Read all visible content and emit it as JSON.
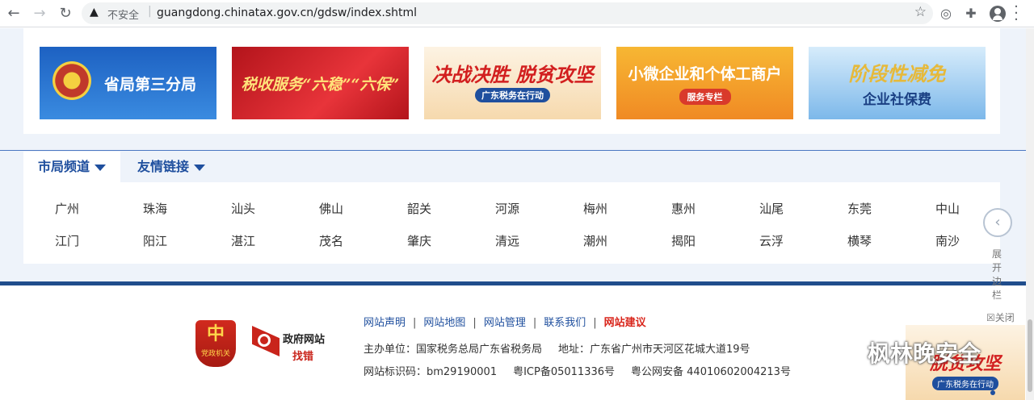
{
  "browser": {
    "back_icon": "arrow-left-icon",
    "forward_icon": "arrow-right-icon",
    "reload_icon": "reload-icon",
    "insecure_label": "不安全",
    "url": "guangdong.chinatax.gov.cn/gdsw/index.shtml"
  },
  "banners": [
    {
      "text": "省局第三分局"
    },
    {
      "text": "税收服务“六稳”“六保”"
    },
    {
      "text": "决战决胜 脱贫攻坚",
      "sub": "广东税务在行动"
    },
    {
      "text": "小微企业和个体工商户",
      "sub": "服务专栏"
    },
    {
      "text": "阶段性减免",
      "sub": "企业社保费"
    }
  ],
  "tabs": {
    "city_channel": "市局频道",
    "friend_links": "友情链接"
  },
  "cities": [
    [
      "广州",
      "珠海",
      "汕头",
      "佛山",
      "韶关",
      "河源",
      "梅州",
      "惠州",
      "汕尾",
      "东莞",
      "中山"
    ],
    [
      "江门",
      "阳江",
      "湛江",
      "茂名",
      "肇庆",
      "清远",
      "潮州",
      "揭阳",
      "云浮",
      "横琴",
      "南沙"
    ]
  ],
  "sidebar": {
    "expand_label": "展开边栏",
    "close_label": "关闭"
  },
  "footer": {
    "party_badge": "党政机关",
    "gov_site_title": "政府网站",
    "gov_site_sub": "找错",
    "links": [
      "网站声明",
      "网站地图",
      "网站管理",
      "联系我们"
    ],
    "suggest_link": "网站建议",
    "host": "主办单位：国家税务总局广东省税务局",
    "address": "地址：广东省广州市天河区花城大道19号",
    "site_id": "网站标识码：bm29190001",
    "icp": "粤ICP备05011336号",
    "police": "粤公网安备 44010602004213号"
  },
  "watermark": "枫林晚安全",
  "float_ad": {
    "text": "脱贫攻坚",
    "sub": "广东税务在行动"
  },
  "colors": {
    "brand_blue": "#1f4f9e",
    "footer_bar": "#204d8c",
    "alert_red": "#d9261c"
  }
}
